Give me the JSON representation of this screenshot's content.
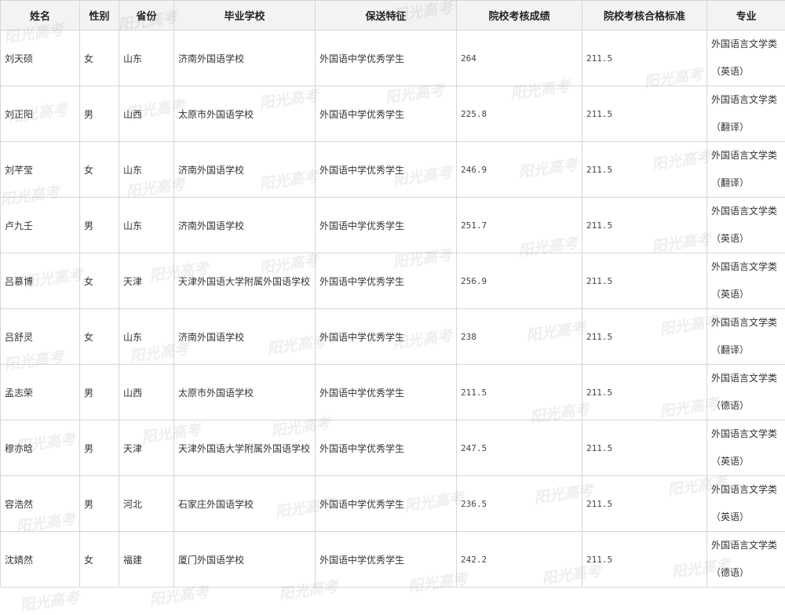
{
  "headers": {
    "name": "姓名",
    "gender": "性别",
    "province": "省份",
    "school": "毕业学校",
    "feature": "保送特征",
    "score": "院校考核成绩",
    "standard": "院校考核合格标准",
    "major": "专业"
  },
  "rows": [
    {
      "name": "刘天硕",
      "gender": "女",
      "province": "山东",
      "school": "济南外国语学校",
      "feature": "外国语中学优秀学生",
      "score": "264",
      "standard": "211.5",
      "major_1": "外国语言文学类",
      "major_2": "（英语）"
    },
    {
      "name": "刘正阳",
      "gender": "男",
      "province": "山西",
      "school": "太原市外国语学校",
      "feature": "外国语中学优秀学生",
      "score": "225.8",
      "standard": "211.5",
      "major_1": "外国语言文学类",
      "major_2": "（翻译）"
    },
    {
      "name": "刘芊莹",
      "gender": "女",
      "province": "山东",
      "school": "济南外国语学校",
      "feature": "外国语中学优秀学生",
      "score": "246.9",
      "standard": "211.5",
      "major_1": "外国语言文学类",
      "major_2": "（翻译）"
    },
    {
      "name": "卢九壬",
      "gender": "男",
      "province": "山东",
      "school": "济南外国语学校",
      "feature": "外国语中学优秀学生",
      "score": "251.7",
      "standard": "211.5",
      "major_1": "外国语言文学类",
      "major_2": "（英语）"
    },
    {
      "name": "吕慕博",
      "gender": "女",
      "province": "天津",
      "school": "天津外国语大学附属外国语学校",
      "feature": "外国语中学优秀学生",
      "score": "256.9",
      "standard": "211.5",
      "major_1": "外国语言文学类",
      "major_2": "（英语）"
    },
    {
      "name": "吕舒灵",
      "gender": "女",
      "province": "山东",
      "school": "济南外国语学校",
      "feature": "外国语中学优秀学生",
      "score": "238",
      "standard": "211.5",
      "major_1": "外国语言文学类",
      "major_2": "（翻译）"
    },
    {
      "name": "孟志荣",
      "gender": "男",
      "province": "山西",
      "school": "太原市外国语学校",
      "feature": "外国语中学优秀学生",
      "score": "211.5",
      "standard": "211.5",
      "major_1": "外国语言文学类",
      "major_2": "（德语）"
    },
    {
      "name": "穆亦晗",
      "gender": "男",
      "province": "天津",
      "school": "天津外国语大学附属外国语学校",
      "feature": "外国语中学优秀学生",
      "score": "247.5",
      "standard": "211.5",
      "major_1": "外国语言文学类",
      "major_2": "（英语）"
    },
    {
      "name": "容浩然",
      "gender": "男",
      "province": "河北",
      "school": "石家庄外国语学校",
      "feature": "外国语中学优秀学生",
      "score": "236.5",
      "standard": "211.5",
      "major_1": "外国语言文学类",
      "major_2": "（英语）"
    },
    {
      "name": "沈婧然",
      "gender": "女",
      "province": "福建",
      "school": "厦门外国语学校",
      "feature": "外国语中学优秀学生",
      "score": "242.2",
      "standard": "211.5",
      "major_1": "外国语言文学类",
      "major_2": "（德语）"
    }
  ],
  "watermark": "阳光高考"
}
